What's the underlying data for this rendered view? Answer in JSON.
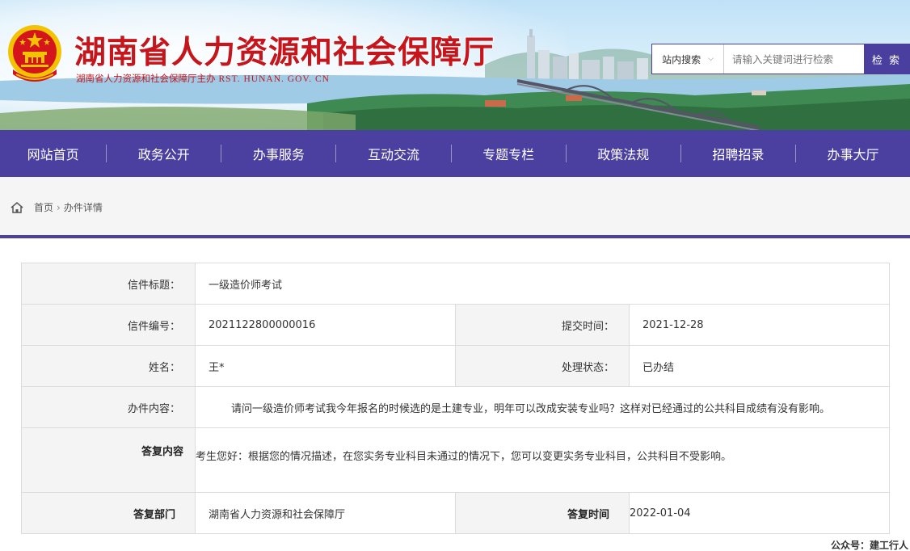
{
  "header": {
    "title": "湖南省人力资源和社会保障厅",
    "subtitle": "湖南省人力资源和社会保障厅主办",
    "domain": "RST. HUNAN. GOV. CN",
    "emblem_icon": "national-emblem-icon",
    "brand_color": "#c4161c"
  },
  "search": {
    "scope": "站内搜索",
    "placeholder": "请输入关键词进行检索",
    "button": "检 索",
    "accent_color": "#4b3fa0"
  },
  "nav": {
    "items": [
      "网站首页",
      "政务公开",
      "办事服务",
      "互动交流",
      "专题专栏",
      "政策法规",
      "招聘招录",
      "办事大厅"
    ]
  },
  "breadcrumb": {
    "home": "首页",
    "current": "办件详情"
  },
  "detail": {
    "title_label": "信件标题：",
    "title_value": "一级造价师考试",
    "number_label": "信件编号：",
    "number_value": "2021122800000016",
    "submit_time_label": "提交时间：",
    "submit_time_value": "2021-12-28",
    "name_label": "姓名：",
    "name_value": "王*",
    "status_label": "处理状态：",
    "status_value": "已办结",
    "content_label": "办件内容：",
    "content_value": "请问一级造价师考试我今年报名的时候选的是土建专业，明年可以改成安装专业吗？这样对已经通过的公共科目成绩有没有影响。",
    "reply_label": "答复内容",
    "reply_value": "考生您好：根据您的情况描述，在您实务专业科目未通过的情况下，您可以变更实务专业科目，公共科目不受影响。",
    "dept_label": "答复部门",
    "dept_value": "湖南省人力资源和社会保障厅",
    "reply_time_label": "答复时间",
    "reply_time_value": "2022-01-04"
  },
  "watermark": "公众号：建工行人"
}
